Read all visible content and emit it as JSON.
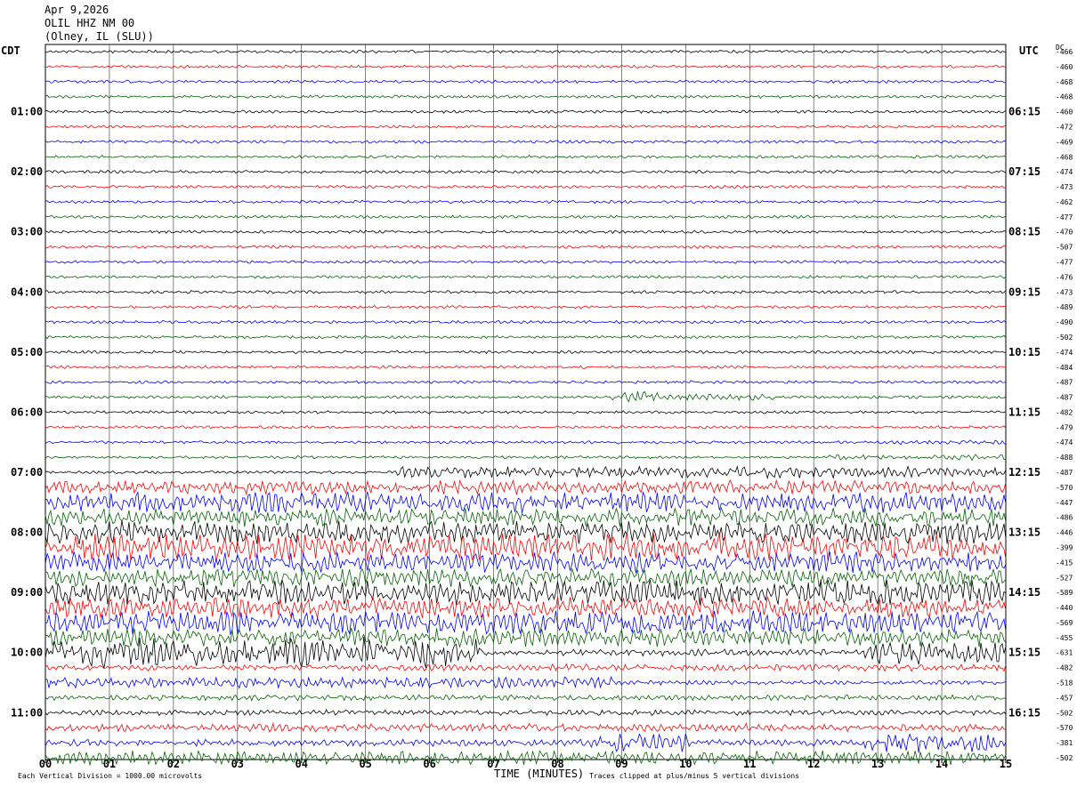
{
  "header": {
    "date": "Apr 9,2026",
    "station": "OLIL HHZ NM 00",
    "location": "(Olney, IL (SLU))"
  },
  "left_timezone": "CDT",
  "right_timezone": "UTC",
  "dc_label": "DC",
  "footer": {
    "scale_note": "Each Vertical Division = 1000.00 microvolts",
    "xlabel": "TIME (MINUTES)",
    "clip_note": "Traces clipped at plus/minus 5 vertical divisions"
  },
  "chart_data": {
    "type": "line",
    "title": "",
    "xlabel": "TIME (MINUTES)",
    "xlim": [
      0,
      15
    ],
    "x_ticks": [
      "00",
      "01",
      "02",
      "03",
      "04",
      "05",
      "06",
      "07",
      "08",
      "09",
      "10",
      "11",
      "12",
      "13",
      "14",
      "15"
    ],
    "grid": true,
    "trace_count": 48,
    "trace_colors": [
      "#000000",
      "#ff0000",
      "#0000ff",
      "#006400"
    ],
    "left_labels": [
      {
        "trace": 4,
        "text": "01:00"
      },
      {
        "trace": 8,
        "text": "02:00"
      },
      {
        "trace": 12,
        "text": "03:00"
      },
      {
        "trace": 16,
        "text": "04:00"
      },
      {
        "trace": 20,
        "text": "05:00"
      },
      {
        "trace": 24,
        "text": "06:00"
      },
      {
        "trace": 28,
        "text": "07:00"
      },
      {
        "trace": 32,
        "text": "08:00"
      },
      {
        "trace": 36,
        "text": "09:00"
      },
      {
        "trace": 40,
        "text": "10:00"
      },
      {
        "trace": 44,
        "text": "11:00"
      }
    ],
    "right_labels": [
      {
        "trace": 4,
        "text": "06:15"
      },
      {
        "trace": 8,
        "text": "07:15"
      },
      {
        "trace": 12,
        "text": "08:15"
      },
      {
        "trace": 16,
        "text": "09:15"
      },
      {
        "trace": 20,
        "text": "10:15"
      },
      {
        "trace": 24,
        "text": "11:15"
      },
      {
        "trace": 28,
        "text": "12:15"
      },
      {
        "trace": 32,
        "text": "13:15"
      },
      {
        "trace": 36,
        "text": "14:15"
      },
      {
        "trace": 40,
        "text": "15:15"
      },
      {
        "trace": 44,
        "text": "16:15"
      }
    ],
    "dc_values": [
      "-466",
      "-460",
      "-468",
      "-468",
      "-460",
      "-472",
      "-469",
      "-468",
      "-474",
      "-473",
      "-462",
      "-477",
      "-470",
      "-507",
      "-477",
      "-476",
      "-473",
      "-489",
      "-490",
      "-502",
      "-474",
      "-484",
      "-487",
      "-487",
      "-482",
      "-479",
      "-474",
      "-488",
      "-487",
      "-570",
      "-447",
      "-486",
      "-446",
      "-399",
      "-415",
      "-527",
      "-589",
      "-440",
      "-569",
      "-455",
      "-631",
      "-482",
      "-518",
      "-457",
      "-502",
      "-570",
      "-381",
      "-502"
    ],
    "activity_segments": [
      {
        "trace": 23,
        "segments": [
          [
            8.8,
            9.6,
            5
          ],
          [
            9.7,
            11.4,
            3
          ]
        ]
      },
      {
        "trace": 26,
        "segments": [
          [
            13.2,
            15,
            2
          ]
        ]
      },
      {
        "trace": 27,
        "segments": [
          [
            12.2,
            15,
            2.5
          ]
        ]
      },
      {
        "trace": 28,
        "segments": [
          [
            5.5,
            15,
            5
          ]
        ]
      },
      {
        "trace": 29,
        "segments": [
          [
            0,
            15,
            6
          ]
        ]
      },
      {
        "trace": 30,
        "segments": [
          [
            0,
            15,
            9
          ]
        ]
      },
      {
        "trace": 31,
        "segments": [
          [
            0,
            15,
            8
          ]
        ]
      },
      {
        "trace": 32,
        "segments": [
          [
            0,
            15,
            10
          ]
        ]
      },
      {
        "trace": 33,
        "segments": [
          [
            0,
            15,
            12
          ]
        ]
      },
      {
        "trace": 34,
        "segments": [
          [
            0,
            15,
            9
          ]
        ]
      },
      {
        "trace": 35,
        "segments": [
          [
            0,
            15,
            8
          ]
        ]
      },
      {
        "trace": 36,
        "segments": [
          [
            0,
            15,
            11
          ]
        ]
      },
      {
        "trace": 37,
        "segments": [
          [
            0,
            15,
            9
          ]
        ]
      },
      {
        "trace": 38,
        "segments": [
          [
            0,
            15,
            10
          ]
        ]
      },
      {
        "trace": 39,
        "segments": [
          [
            0,
            15,
            8
          ]
        ]
      },
      {
        "trace": 40,
        "segments": [
          [
            0,
            6.8,
            14
          ],
          [
            6.8,
            12.8,
            3
          ],
          [
            12.8,
            15,
            10
          ]
        ]
      },
      {
        "trace": 41,
        "segments": [
          [
            0,
            15,
            3
          ]
        ]
      },
      {
        "trace": 42,
        "segments": [
          [
            0,
            9,
            5
          ],
          [
            9,
            15,
            2
          ]
        ]
      },
      {
        "trace": 43,
        "segments": [
          [
            0,
            15,
            2.5
          ]
        ]
      },
      {
        "trace": 44,
        "segments": [
          [
            0,
            15,
            2.5
          ]
        ]
      },
      {
        "trace": 45,
        "segments": [
          [
            0,
            15,
            3.5
          ]
        ]
      },
      {
        "trace": 46,
        "segments": [
          [
            0,
            8.5,
            3
          ],
          [
            8.5,
            10,
            8
          ],
          [
            10,
            12.8,
            3
          ],
          [
            12.8,
            15,
            9
          ]
        ]
      },
      {
        "trace": 47,
        "segments": [
          [
            0,
            15,
            6
          ]
        ]
      }
    ]
  }
}
